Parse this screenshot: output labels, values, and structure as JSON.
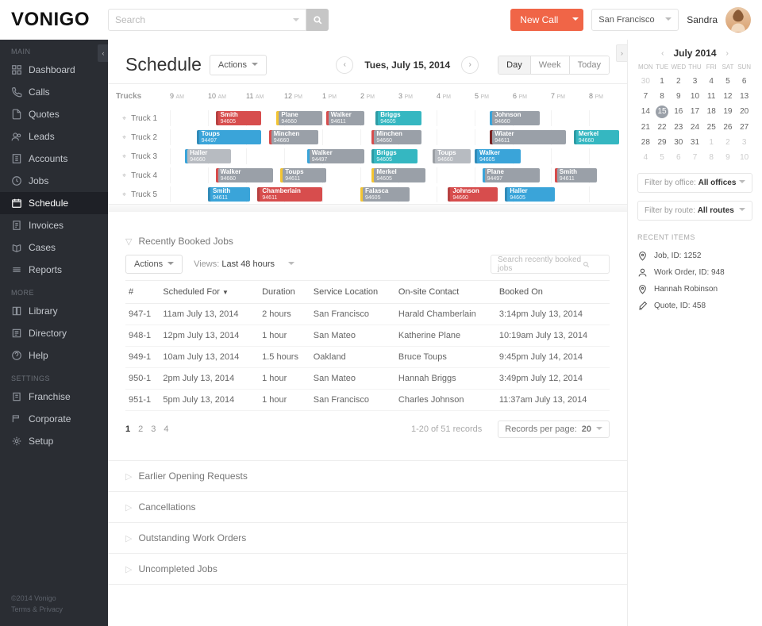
{
  "brand": "VONIGO",
  "search_placeholder": "Search",
  "new_call_label": "New Call",
  "city": "San Francisco",
  "username": "Sandra",
  "nav": {
    "main_label": "MAIN",
    "more_label": "MORE",
    "settings_label": "SETTINGS",
    "main": [
      "Dashboard",
      "Calls",
      "Quotes",
      "Leads",
      "Accounts",
      "Jobs",
      "Schedule",
      "Invoices",
      "Cases",
      "Reports"
    ],
    "more": [
      "Library",
      "Directory",
      "Help"
    ],
    "settings": [
      "Franchise",
      "Corporate",
      "Setup"
    ]
  },
  "footer": {
    "copyright": "©2014 Vonigo",
    "terms": "Terms & Privacy"
  },
  "schedule": {
    "title": "Schedule",
    "actions": "Actions",
    "date": "Tues, July 15, 2014",
    "views": [
      "Day",
      "Week",
      "Today"
    ],
    "active_view": "Day",
    "trucks_label": "Trucks",
    "hours": [
      {
        "h": "9",
        "p": "AM"
      },
      {
        "h": "10",
        "p": "AM"
      },
      {
        "h": "11",
        "p": "AM"
      },
      {
        "h": "12",
        "p": "PM"
      },
      {
        "h": "1",
        "p": "PM"
      },
      {
        "h": "2",
        "p": "PM"
      },
      {
        "h": "3",
        "p": "PM"
      },
      {
        "h": "4",
        "p": "PM"
      },
      {
        "h": "5",
        "p": "PM"
      },
      {
        "h": "6",
        "p": "PM"
      },
      {
        "h": "7",
        "p": "PM"
      },
      {
        "h": "8",
        "p": "PM"
      }
    ],
    "rows": [
      {
        "label": "Truck 1",
        "jobs": [
          {
            "start": 1.2,
            "span": 1.2,
            "name": "Smith",
            "code": "94605",
            "cls": "c-red"
          },
          {
            "start": 2.8,
            "span": 1.2,
            "name": "Plane",
            "code": "94660",
            "cls": "c-grey c-yellow"
          },
          {
            "start": 4.1,
            "span": 1.0,
            "name": "Walker",
            "code": "94611",
            "cls": "c-grey t-red"
          },
          {
            "start": 5.4,
            "span": 1.2,
            "name": "Briggs",
            "code": "94605",
            "cls": "c-teal"
          },
          {
            "start": 8.4,
            "span": 1.3,
            "name": "Johnson",
            "code": "94660",
            "cls": "c-grey t-blue"
          }
        ]
      },
      {
        "label": "Truck 2",
        "jobs": [
          {
            "start": 0.7,
            "span": 1.7,
            "name": "Toups",
            "code": "94497",
            "cls": "c-blue"
          },
          {
            "start": 2.6,
            "span": 1.3,
            "name": "Minchen",
            "code": "94660",
            "cls": "c-grey t-red"
          },
          {
            "start": 5.3,
            "span": 1.3,
            "name": "Minchen",
            "code": "94660",
            "cls": "c-grey t-red"
          },
          {
            "start": 8.4,
            "span": 2.0,
            "name": "Wiater",
            "code": "94611",
            "cls": "c-grey t-darkred"
          },
          {
            "start": 10.6,
            "span": 1.2,
            "name": "Merkel",
            "code": "94660",
            "cls": "c-teal"
          }
        ]
      },
      {
        "label": "Truck 3",
        "jobs": [
          {
            "start": 0.4,
            "span": 1.2,
            "name": "Haller",
            "code": "94660",
            "cls": "c-grey2 t-blue"
          },
          {
            "start": 3.6,
            "span": 1.5,
            "name": "Walker",
            "code": "94497",
            "cls": "c-grey t-blue"
          },
          {
            "start": 5.3,
            "span": 1.2,
            "name": "Briggs",
            "code": "94605",
            "cls": "c-teal"
          },
          {
            "start": 6.9,
            "span": 1.0,
            "name": "Toups",
            "code": "94660",
            "cls": "c-grey2"
          },
          {
            "start": 8.0,
            "span": 1.2,
            "name": "Walker",
            "code": "94605",
            "cls": "c-blue"
          }
        ]
      },
      {
        "label": "Truck 4",
        "jobs": [
          {
            "start": 1.2,
            "span": 1.5,
            "name": "Walker",
            "code": "94660",
            "cls": "c-grey t-red"
          },
          {
            "start": 2.9,
            "span": 1.2,
            "name": "Toups",
            "code": "94611",
            "cls": "c-grey c-yellow"
          },
          {
            "start": 5.3,
            "span": 1.4,
            "name": "Merkel",
            "code": "94605",
            "cls": "c-grey c-yellow"
          },
          {
            "start": 8.2,
            "span": 1.5,
            "name": "Plane",
            "code": "94497",
            "cls": "c-grey t-blue"
          },
          {
            "start": 10.1,
            "span": 1.1,
            "name": "Smith",
            "code": "94611",
            "cls": "c-grey t-red"
          }
        ]
      },
      {
        "label": "Truck 5",
        "jobs": [
          {
            "start": 1.0,
            "span": 1.1,
            "name": "Smith",
            "code": "94611",
            "cls": "c-blue"
          },
          {
            "start": 2.3,
            "span": 1.7,
            "name": "Chamberlain",
            "code": "94611",
            "cls": "c-red"
          },
          {
            "start": 5.0,
            "span": 1.3,
            "name": "Falasca",
            "code": "94605",
            "cls": "c-grey c-yellow"
          },
          {
            "start": 7.3,
            "span": 1.3,
            "name": "Johnson",
            "code": "94660",
            "cls": "c-red"
          },
          {
            "start": 8.8,
            "span": 1.3,
            "name": "Haller",
            "code": "94605",
            "cls": "c-blue"
          }
        ]
      }
    ]
  },
  "recent_jobs": {
    "title": "Recently Booked Jobs",
    "actions": "Actions",
    "views_label": "Views:",
    "views_value": "Last 48 hours",
    "search_placeholder": "Search recently booked jobs",
    "cols": [
      "#",
      "Scheduled For",
      "Duration",
      "Service Location",
      "On-site Contact",
      "Booked On"
    ],
    "sort_col": 1,
    "rows": [
      [
        "947-1",
        "11am July 13, 2014",
        "2 hours",
        "San Francisco",
        "Harald Chamberlain",
        "3:14pm July 13, 2014"
      ],
      [
        "948-1",
        "12pm July 13, 2014",
        "1 hour",
        "San Mateo",
        "Katherine Plane",
        "10:19am July 13, 2014"
      ],
      [
        "949-1",
        "10am July 13, 2014",
        "1.5 hours",
        "Oakland",
        "Bruce Toups",
        "9:45pm July 14, 2014"
      ],
      [
        "950-1",
        "2pm July 13, 2014",
        "1 hour",
        "San Mateo",
        "Hannah Briggs",
        "3:49pm July 12, 2014"
      ],
      [
        "951-1",
        "5pm July 13, 2014",
        "1 hour",
        "San Francisco",
        "Charles Johnson",
        "11:37am July 13, 2014"
      ]
    ],
    "pages": [
      "1",
      "2",
      "3",
      "4"
    ],
    "records_info": "1-20 of 51 records",
    "rpp_label": "Records per page:",
    "rpp_value": "20"
  },
  "accordions": [
    "Earlier Opening Requests",
    "Cancellations",
    "Outstanding Work Orders",
    "Uncompleted Jobs"
  ],
  "calendar": {
    "month": "July 2014",
    "dow": [
      "MON",
      "TUE",
      "WED",
      "THU",
      "FRI",
      "SAT",
      "SUN"
    ],
    "weeks": [
      [
        {
          "d": "30",
          "m": 1
        },
        {
          "d": "1"
        },
        {
          "d": "2"
        },
        {
          "d": "3"
        },
        {
          "d": "4"
        },
        {
          "d": "5"
        },
        {
          "d": "6"
        }
      ],
      [
        {
          "d": "7"
        },
        {
          "d": "8"
        },
        {
          "d": "9"
        },
        {
          "d": "10"
        },
        {
          "d": "11"
        },
        {
          "d": "12"
        },
        {
          "d": "13"
        }
      ],
      [
        {
          "d": "14"
        },
        {
          "d": "15",
          "t": 1
        },
        {
          "d": "16"
        },
        {
          "d": "17"
        },
        {
          "d": "18"
        },
        {
          "d": "19"
        },
        {
          "d": "20"
        }
      ],
      [
        {
          "d": "21"
        },
        {
          "d": "22"
        },
        {
          "d": "23"
        },
        {
          "d": "24"
        },
        {
          "d": "25"
        },
        {
          "d": "26"
        },
        {
          "d": "27"
        }
      ],
      [
        {
          "d": "28"
        },
        {
          "d": "29"
        },
        {
          "d": "30"
        },
        {
          "d": "31"
        },
        {
          "d": "1",
          "m": 1
        },
        {
          "d": "2",
          "m": 1
        },
        {
          "d": "3",
          "m": 1
        }
      ],
      [
        {
          "d": "4",
          "m": 1
        },
        {
          "d": "5",
          "m": 1
        },
        {
          "d": "6",
          "m": 1
        },
        {
          "d": "7",
          "m": 1
        },
        {
          "d": "8",
          "m": 1
        },
        {
          "d": "9",
          "m": 1
        },
        {
          "d": "10",
          "m": 1
        }
      ]
    ]
  },
  "filters": {
    "office_label": "Filter by office:",
    "office_value": "All offices",
    "route_label": "Filter by route:",
    "route_value": "All routes"
  },
  "recent_items": {
    "label": "RECENT ITEMS",
    "items": [
      {
        "icon": "pin",
        "text": "Job, ID: 1252"
      },
      {
        "icon": "user",
        "text": "Work Order, ID: 948"
      },
      {
        "icon": "pin",
        "text": "Hannah Robinson"
      },
      {
        "icon": "edit",
        "text": "Quote, ID: 458"
      }
    ]
  }
}
